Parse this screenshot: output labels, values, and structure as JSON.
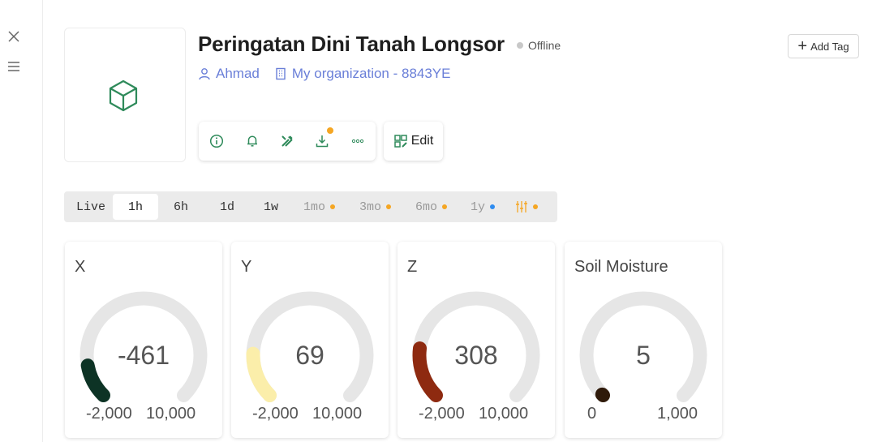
{
  "left_rail": {
    "close_icon": "close-icon",
    "menu_icon": "menu-icon"
  },
  "device": {
    "icon": "cube-icon",
    "title": "Peringatan Dini Tanah Longsor",
    "status": "Offline",
    "owner": "Ahmad",
    "organization": "My organization - 8843YE"
  },
  "header": {
    "add_tag_label": "Add Tag"
  },
  "actions": {
    "items": [
      "info-icon",
      "bell-icon",
      "tools-icon",
      "download-icon",
      "more-icon"
    ],
    "edit_label": "Edit"
  },
  "time_ranges": [
    {
      "label": "Live"
    },
    {
      "label": "1h",
      "active": true
    },
    {
      "label": "6h"
    },
    {
      "label": "1d"
    },
    {
      "label": "1w"
    },
    {
      "label": "1mo",
      "dot": "#f5a623"
    },
    {
      "label": "3mo",
      "dot": "#f5a623"
    },
    {
      "label": "6mo",
      "dot": "#f5a623"
    },
    {
      "label": "1y",
      "dot": "#2f8cf0"
    }
  ],
  "time_filter_icon": "sliders-icon",
  "gauges": [
    {
      "title": "X",
      "value": -461,
      "value_text": "-461",
      "min": -2000,
      "max": 10000,
      "min_text": "-2,000",
      "max_text": "10,000",
      "color": "#0d3325"
    },
    {
      "title": "Y",
      "value": 69,
      "value_text": "69",
      "min": -2000,
      "max": 10000,
      "min_text": "-2,000",
      "max_text": "10,000",
      "color": "#fbeeaa"
    },
    {
      "title": "Z",
      "value": 308,
      "value_text": "308",
      "min": -2000,
      "max": 10000,
      "min_text": "-2,000",
      "max_text": "10,000",
      "color": "#8e2a10"
    },
    {
      "title": "Soil Moisture",
      "value": 5,
      "value_text": "5",
      "min": 0,
      "max": 1000,
      "min_text": "0",
      "max_text": "1,000",
      "color": "#2f1a0a"
    }
  ],
  "colors": {
    "accent_green": "#2e8a5a",
    "link_blue": "#6a7fd8",
    "track_gray": "#e6e6e6"
  }
}
